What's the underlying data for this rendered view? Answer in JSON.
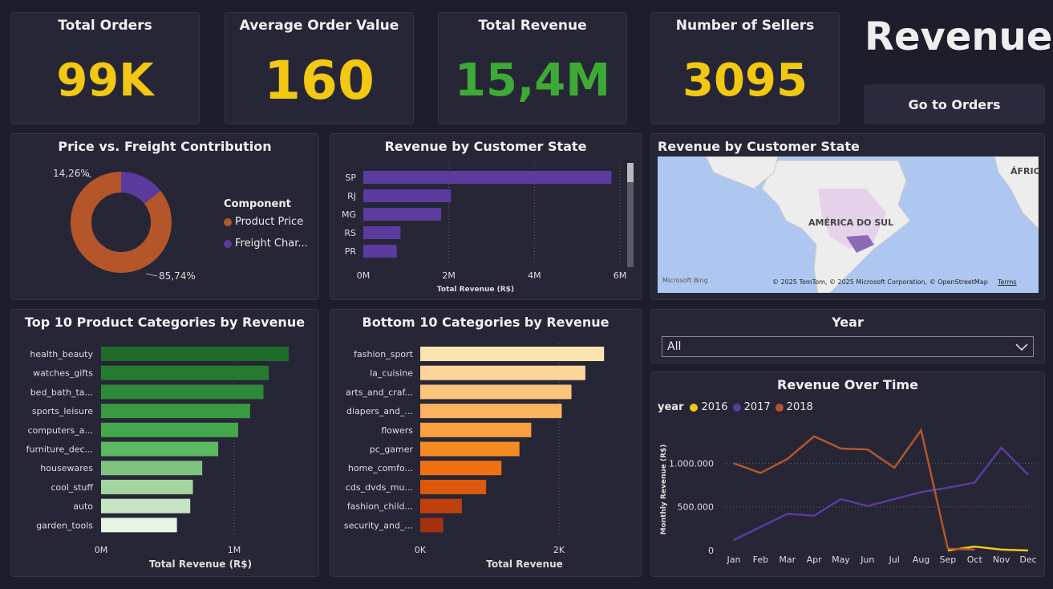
{
  "kpis": {
    "orders": {
      "title": "Total Orders",
      "value": "99K"
    },
    "aov": {
      "title": "Average Order Value",
      "value": "160"
    },
    "revenue": {
      "title": "Total Revenue",
      "value": "15,4M"
    },
    "sellers": {
      "title": "Number of Sellers",
      "value": "3095"
    }
  },
  "page_title": "Revenue",
  "nav_button": "Go to Orders",
  "colors": {
    "yellow": "#f2c811",
    "green": "#3daa35",
    "price": "#b4562a",
    "freight": "#5c3b9e",
    "bar_purple": "#5c3b9e"
  },
  "donut": {
    "title": "Price vs. Freight Contribution",
    "legend_title": "Component",
    "labels": [
      "Product Price",
      "Freight Char..."
    ],
    "values": [
      85.74,
      14.26
    ],
    "value_labels": [
      "85,74%",
      "14,26%"
    ]
  },
  "state_bar": {
    "title": "Revenue by Customer State",
    "xlabel": "Total Revenue (R$)",
    "ticks": [
      "0M",
      "2M",
      "4M",
      "6M"
    ]
  },
  "map": {
    "title": "Revenue by Customer State",
    "label_continent": "AMÉRICA DO SUL",
    "label_africa": "ÁFRIC",
    "credit": "© 2025 TomTom, © 2025 Microsoft Corporation, © OpenStreetMap",
    "terms": "Terms",
    "logo": "Microsoft Bing"
  },
  "top10": {
    "title": "Top 10 Product Categories by Revenue",
    "xlabel": "Total Revenue (R$)",
    "ticks": [
      "0M",
      "1M"
    ]
  },
  "bottom10": {
    "title": "Bottom 10 Categories by Revenue",
    "xlabel": "Total Revenue",
    "ticks": [
      "0K",
      "2K"
    ]
  },
  "year_filter": {
    "title": "Year",
    "value": "All"
  },
  "line": {
    "title": "Revenue Over Time",
    "legend_title": "year",
    "ylabel": "Monthly Revenue (R$)",
    "yticks": [
      "1.000.000",
      "500.000",
      "0"
    ]
  },
  "chart_data": [
    {
      "type": "pie",
      "title": "Price vs. Freight Contribution",
      "categories": [
        "Product Price",
        "Freight Char..."
      ],
      "values": [
        85.74,
        14.26
      ]
    },
    {
      "type": "bar",
      "title": "Revenue by Customer State",
      "categories": [
        "SP",
        "RJ",
        "MG",
        "RS",
        "PR"
      ],
      "values": [
        5800000,
        2050000,
        1820000,
        870000,
        780000
      ],
      "xlabel": "Total Revenue (R$)",
      "xlim": [
        0,
        6000000
      ]
    },
    {
      "type": "bar",
      "title": "Top 10 Product Categories by Revenue",
      "categories": [
        "health_beauty",
        "watches_gifts",
        "bed_bath_ta...",
        "sports_leisure",
        "computers_a...",
        "furniture_dec...",
        "housewares",
        "cool_stuff",
        "auto",
        "garden_tools"
      ],
      "values": [
        1410000,
        1260000,
        1220000,
        1120000,
        1030000,
        880000,
        760000,
        690000,
        670000,
        570000
      ],
      "xlabel": "Total Revenue (R$)"
    },
    {
      "type": "bar",
      "title": "Bottom 10 Categories by Revenue",
      "categories": [
        "fashion_sport",
        "la_cuisine",
        "arts_and_craf...",
        "diapers_and_...",
        "flowers",
        "pc_gamer",
        "home_comfo...",
        "cds_dvds_mu...",
        "fashion_child...",
        "security_and_..."
      ],
      "values": [
        2650,
        2380,
        2180,
        2040,
        1600,
        1430,
        1170,
        950,
        600,
        330
      ],
      "xlabel": "Total Revenue"
    },
    {
      "type": "line",
      "title": "Revenue Over Time",
      "x": [
        "Jan",
        "Feb",
        "Mar",
        "Apr",
        "May",
        "Jun",
        "Jul",
        "Aug",
        "Sep",
        "Oct",
        "Nov",
        "Dec"
      ],
      "ylabel": "Monthly Revenue (R$)",
      "ylim": [
        0,
        1400000
      ],
      "series": [
        {
          "name": "2016",
          "values": [
            null,
            null,
            null,
            null,
            null,
            null,
            null,
            null,
            0,
            45000,
            10000,
            0
          ]
        },
        {
          "name": "2017",
          "values": [
            120000,
            270000,
            420000,
            400000,
            590000,
            510000,
            590000,
            670000,
            720000,
            780000,
            1180000,
            870000
          ]
        },
        {
          "name": "2018",
          "values": [
            1000000,
            890000,
            1050000,
            1310000,
            1170000,
            1160000,
            950000,
            1380000,
            20000,
            10000,
            null,
            null
          ]
        }
      ]
    }
  ]
}
